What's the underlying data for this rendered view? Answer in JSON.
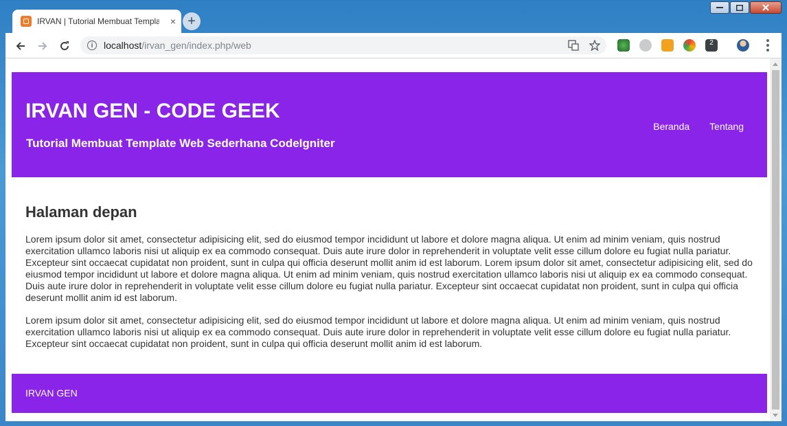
{
  "browser": {
    "tab_title": "IRVAN | Tutorial Membuat Template Web Sederhana CodeIgniter",
    "tab_close": "×",
    "new_tab": "+",
    "url_host": "localhost",
    "url_path": "/irvan_gen/index.php/web",
    "info_icon": "i",
    "extension_badge": "2"
  },
  "site": {
    "title": "IRVAN GEN - CODE GEEK",
    "subtitle": "Tutorial Membuat Template Web Sederhana CodeIgniter",
    "nav": {
      "home": "Beranda",
      "about": "Tentang"
    },
    "accent_color": "#8a24e8"
  },
  "content": {
    "heading": "Halaman depan",
    "paragraph_1": "Lorem ipsum dolor sit amet, consectetur adipisicing elit, sed do eiusmod tempor incididunt ut labore et dolore magna aliqua. Ut enim ad minim veniam, quis nostrud exercitation ullamco laboris nisi ut aliquip ex ea commodo consequat. Duis aute irure dolor in reprehenderit in voluptate velit esse cillum dolore eu fugiat nulla pariatur. Excepteur sint occaecat cupidatat non proident, sunt in culpa qui officia deserunt mollit anim id est laborum. Lorem ipsum dolor sit amet, consectetur adipisicing elit, sed do eiusmod tempor incididunt ut labore et dolore magna aliqua. Ut enim ad minim veniam, quis nostrud exercitation ullamco laboris nisi ut aliquip ex ea commodo consequat. Duis aute irure dolor in reprehenderit in voluptate velit esse cillum dolore eu fugiat nulla pariatur. Excepteur sint occaecat cupidatat non proident, sunt in culpa qui officia deserunt mollit anim id est laborum.",
    "paragraph_2": "Lorem ipsum dolor sit amet, consectetur adipisicing elit, sed do eiusmod tempor incididunt ut labore et dolore magna aliqua. Ut enim ad minim veniam, quis nostrud exercitation ullamco laboris nisi ut aliquip ex ea commodo consequat. Duis aute irure dolor in reprehenderit in voluptate velit esse cillum dolore eu fugiat nulla pariatur. Excepteur sint occaecat cupidatat non proident, sunt in culpa qui officia deserunt mollit anim id est laborum."
  },
  "footer": {
    "text": "IRVAN GEN"
  }
}
